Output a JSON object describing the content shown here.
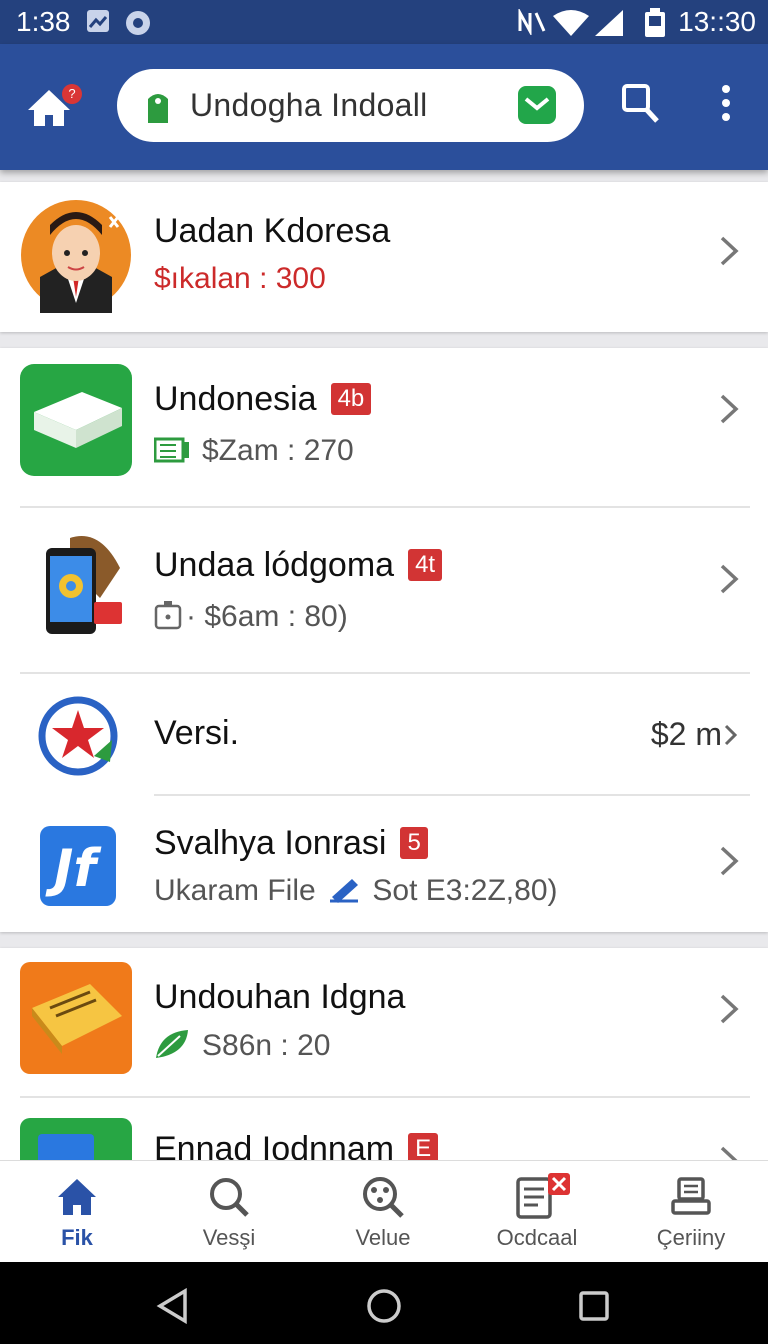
{
  "status": {
    "time_left": "1:38",
    "time_right": "13::30"
  },
  "header": {
    "title": "Undogha Indoall",
    "notification_count": "?",
    "brand_color": "#2b4f9b"
  },
  "profile": {
    "name": "Uadan Kdoresa",
    "value": "$ıkalan : 300"
  },
  "list": {
    "item1": {
      "title": "Undonesia",
      "badge": "4b",
      "sub": "$Zam : 270"
    },
    "item2": {
      "title": "Undaa lódgoma",
      "badge": "4t",
      "sub": "· $6am : 80)"
    },
    "item3": {
      "title": "Versi.",
      "trail": "$2 m"
    },
    "item4": {
      "title": "Svalhya Ionrasi",
      "badge": "5",
      "sub_a": "Ukaram File",
      "sub_b": "Sot E3:2Z,80)"
    },
    "item5": {
      "title": "Undouhan Idgna",
      "sub": "S86n : 20"
    },
    "item6": {
      "title": "Ennad Iodnnam",
      "badge": "E"
    }
  },
  "nav": [
    {
      "label": "Fik",
      "icon": "home-icon",
      "active": true
    },
    {
      "label": "Vesşi",
      "icon": "search-icon"
    },
    {
      "label": "Velue",
      "icon": "film-reel-icon"
    },
    {
      "label": "Ocdcaal",
      "icon": "document-icon"
    },
    {
      "label": "Çeriiny",
      "icon": "printer-icon"
    }
  ]
}
